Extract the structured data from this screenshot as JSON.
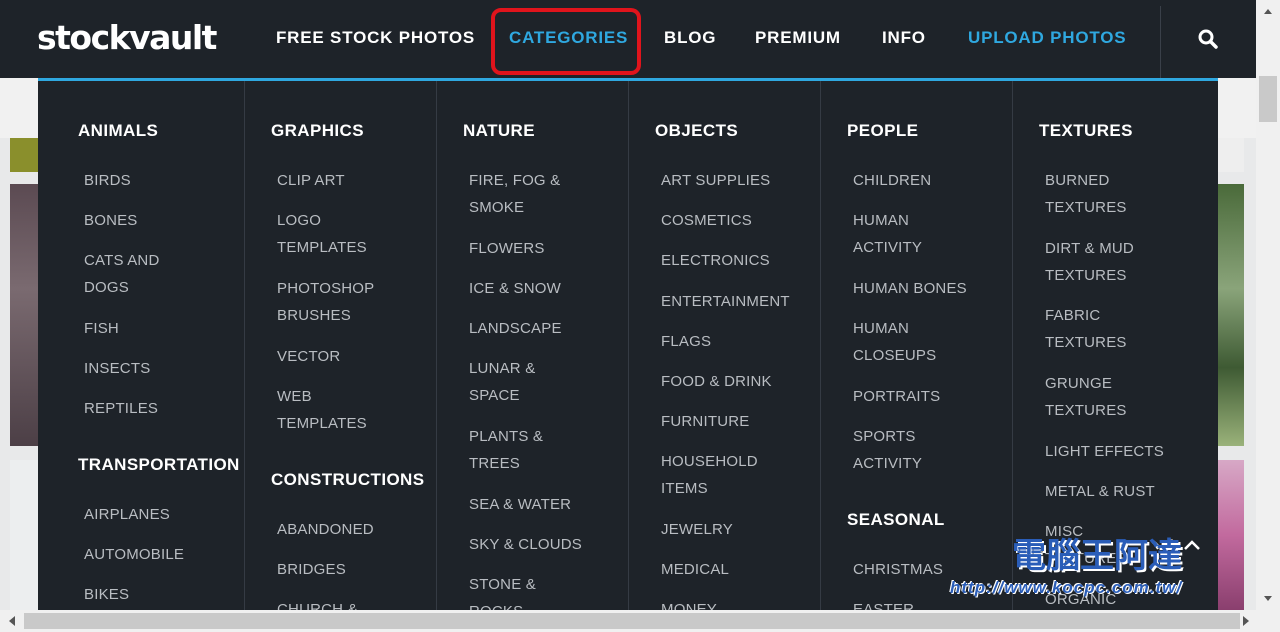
{
  "header": {
    "logo": "stockvault",
    "nav": [
      {
        "label": "FREE STOCK PHOTOS"
      },
      {
        "label": "CATEGORIES"
      },
      {
        "label": "BLOG"
      },
      {
        "label": "PREMIUM"
      },
      {
        "label": "INFO"
      },
      {
        "label": "UPLOAD PHOTOS"
      }
    ],
    "accent_color": "#2fa8e0",
    "highlight_color": "#e0141c",
    "search_icon": "search-icon"
  },
  "menu": {
    "animals": {
      "heading": "ANIMALS",
      "items": [
        "BIRDS",
        "BONES",
        "CATS AND\nDOGS",
        "FISH",
        "INSECTS",
        "REPTILES"
      ]
    },
    "transportation": {
      "heading": "TRANSPORTATION",
      "items": [
        "AIRPLANES",
        "AUTOMOBILE",
        "BIKES"
      ]
    },
    "graphics": {
      "heading": "GRAPHICS",
      "items": [
        "CLIP ART",
        "LOGO\nTEMPLATES",
        "PHOTOSHOP\nBRUSHES",
        "VECTOR",
        "WEB\nTEMPLATES"
      ]
    },
    "constructions": {
      "heading": "CONSTRUCTIONS",
      "items": [
        "ABANDONED",
        "BRIDGES",
        "CHURCH &"
      ]
    },
    "nature": {
      "heading": "NATURE",
      "items": [
        "FIRE, FOG &\nSMOKE",
        "FLOWERS",
        "ICE & SNOW",
        "LANDSCAPE",
        "LUNAR &\nSPACE",
        "PLANTS &\nTREES",
        "SEA & WATER",
        "SKY & CLOUDS",
        "STONE &\nROCKS"
      ]
    },
    "objects": {
      "heading": "OBJECTS",
      "items": [
        "ART SUPPLIES",
        "COSMETICS",
        "ELECTRONICS",
        "ENTERTAINMENT",
        "FLAGS",
        "FOOD & DRINK",
        "FURNITURE",
        "HOUSEHOLD\nITEMS",
        "JEWELRY",
        "MEDICAL",
        "MONEY"
      ]
    },
    "people": {
      "heading": "PEOPLE",
      "items": [
        "CHILDREN",
        "HUMAN\nACTIVITY",
        "HUMAN BONES",
        "HUMAN\nCLOSEUPS",
        "PORTRAITS",
        "SPORTS\nACTIVITY"
      ]
    },
    "seasonal": {
      "heading": "SEASONAL",
      "items": [
        "CHRISTMAS",
        "EASTER"
      ]
    },
    "textures": {
      "heading": "TEXTURES",
      "items": [
        "BURNED\nTEXTURES",
        "DIRT & MUD\nTEXTURES",
        "FABRIC\nTEXTURES",
        "GRUNGE\nTEXTURES",
        "LIGHT EFFECTS",
        "METAL & RUST",
        "MISC\nTEXTURES",
        "ORGANIC"
      ]
    }
  },
  "watermark": {
    "url": "http://www.kocpc.com.tw/",
    "logo": "電腦王阿達"
  }
}
